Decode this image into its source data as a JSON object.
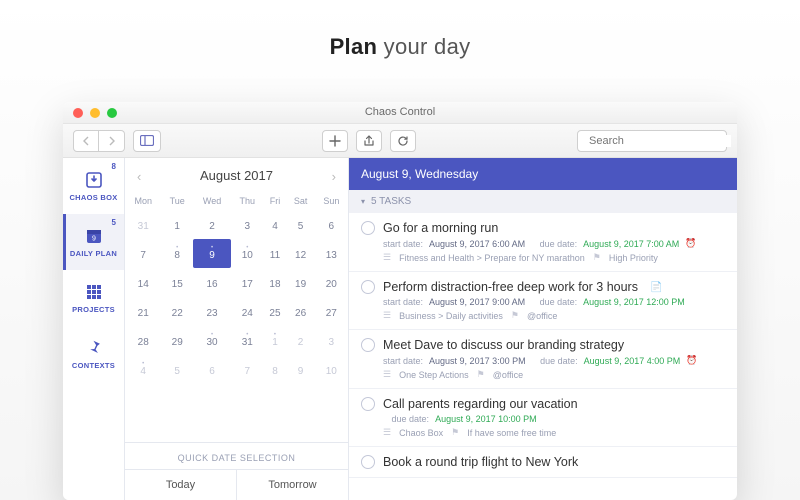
{
  "headline": {
    "bold": "Plan",
    "rest": " your day"
  },
  "window_title": "Chaos Control",
  "toolbar": {
    "search_placeholder": "Search"
  },
  "rail": [
    {
      "key": "chaos-box",
      "label": "CHAOS BOX",
      "badge": "8"
    },
    {
      "key": "daily-plan",
      "label": "DAILY PLAN",
      "badge": "5"
    },
    {
      "key": "projects",
      "label": "PROJECTS",
      "badge": ""
    },
    {
      "key": "contexts",
      "label": "CONTEXTS",
      "badge": ""
    }
  ],
  "calendar": {
    "month_label": "August 2017",
    "weekdays": [
      "Mon",
      "Tue",
      "Wed",
      "Thu",
      "Fri",
      "Sat",
      "Sun"
    ],
    "rows": [
      [
        {
          "n": "31",
          "other": true
        },
        {
          "n": "1"
        },
        {
          "n": "2"
        },
        {
          "n": "3"
        },
        {
          "n": "4"
        },
        {
          "n": "5"
        },
        {
          "n": "6"
        }
      ],
      [
        {
          "n": "7"
        },
        {
          "n": "8",
          "dot": true
        },
        {
          "n": "9",
          "dot": true,
          "sel": true
        },
        {
          "n": "10",
          "dot": true
        },
        {
          "n": "11"
        },
        {
          "n": "12"
        },
        {
          "n": "13"
        }
      ],
      [
        {
          "n": "14"
        },
        {
          "n": "15"
        },
        {
          "n": "16"
        },
        {
          "n": "17"
        },
        {
          "n": "18"
        },
        {
          "n": "19"
        },
        {
          "n": "20"
        }
      ],
      [
        {
          "n": "21"
        },
        {
          "n": "22"
        },
        {
          "n": "23"
        },
        {
          "n": "24"
        },
        {
          "n": "25"
        },
        {
          "n": "26"
        },
        {
          "n": "27"
        }
      ],
      [
        {
          "n": "28"
        },
        {
          "n": "29"
        },
        {
          "n": "30",
          "dot": true
        },
        {
          "n": "31",
          "dot": true
        },
        {
          "n": "1",
          "other": true,
          "dot": true
        },
        {
          "n": "2",
          "other": true
        },
        {
          "n": "3",
          "other": true
        }
      ],
      [
        {
          "n": "4",
          "other": true,
          "dot": true
        },
        {
          "n": "5",
          "other": true
        },
        {
          "n": "6",
          "other": true
        },
        {
          "n": "7",
          "other": true
        },
        {
          "n": "8",
          "other": true
        },
        {
          "n": "9",
          "other": true
        },
        {
          "n": "10",
          "other": true
        }
      ]
    ],
    "quick_label": "QUICK DATE SELECTION",
    "quick": [
      "Today",
      "Tomorrow"
    ]
  },
  "day_header": "August 9, Wednesday",
  "task_count_label": "5 TASKS",
  "tasks": [
    {
      "title": "Go for a morning run",
      "start_label": "start date:",
      "start": "August 9, 2017 6:00 AM",
      "due_label": "due date:",
      "due": "August 9, 2017 7:00 AM",
      "alarm": true,
      "path": "Fitness and Health > Prepare for NY marathon",
      "context": "High Priority"
    },
    {
      "title": "Perform distraction-free deep work for 3 hours",
      "attachment": true,
      "start_label": "start date:",
      "start": "August 9, 2017 9:00 AM",
      "due_label": "due date:",
      "due": "August 9, 2017 12:00 PM",
      "path": "Business > Daily activities",
      "context": "@office"
    },
    {
      "title": "Meet Dave to discuss our branding strategy",
      "start_label": "start date:",
      "start": "August 9, 2017 3:00 PM",
      "due_label": "due date:",
      "due": "August 9, 2017 4:00 PM",
      "alarm": true,
      "path": "One Step Actions",
      "context": "@office"
    },
    {
      "title": "Call parents regarding our vacation",
      "due_label": "due date:",
      "due": "August 9, 2017 10:00 PM",
      "path": "Chaos Box",
      "context": "If have some free time"
    },
    {
      "title": "Book a round trip flight to New York"
    }
  ]
}
